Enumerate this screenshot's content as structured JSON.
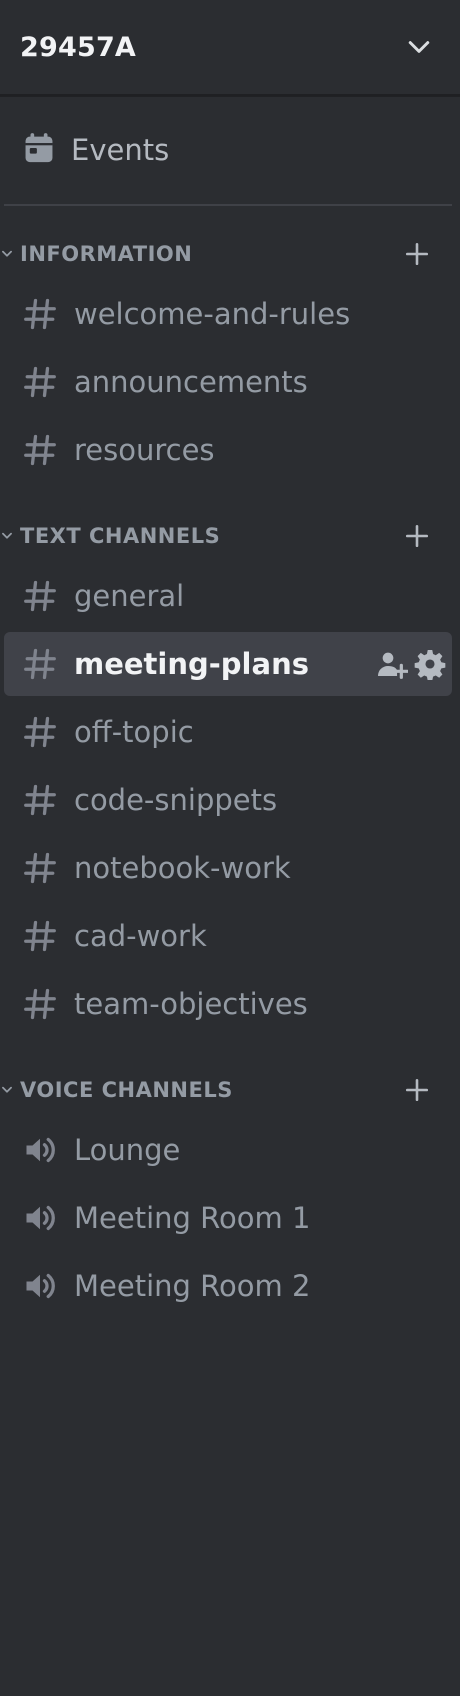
{
  "server": {
    "name": "29457A"
  },
  "events": {
    "label": "Events"
  },
  "categories": [
    {
      "label": "INFORMATION",
      "channels": [
        {
          "label": "welcome-and-rules"
        },
        {
          "label": "announcements"
        },
        {
          "label": "resources"
        }
      ]
    },
    {
      "label": "TEXT CHANNELS",
      "channels": [
        {
          "label": "general"
        },
        {
          "label": "meeting-plans"
        },
        {
          "label": "off-topic"
        },
        {
          "label": "code-snippets"
        },
        {
          "label": "notebook-work"
        },
        {
          "label": "cad-work"
        },
        {
          "label": "team-objectives"
        }
      ]
    },
    {
      "label": "VOICE CHANNELS",
      "channels": [
        {
          "label": "Lounge"
        },
        {
          "label": "Meeting Room 1"
        },
        {
          "label": "Meeting Room 2"
        }
      ]
    }
  ],
  "selected_channel": "meeting-plans",
  "colors": {
    "background": "#2b2d31",
    "selected_bg": "#404249",
    "text_muted": "#949ba4",
    "text_bright": "#f2f3f5"
  }
}
